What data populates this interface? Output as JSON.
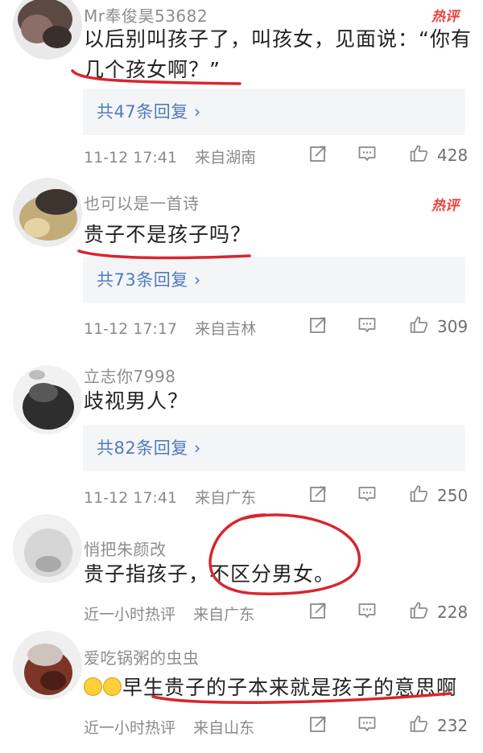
{
  "labels": {
    "hot": "热评"
  },
  "colors": {
    "accent_red": "#d8262f",
    "link_blue": "#4f7bbd",
    "hot_red": "#e8453c"
  },
  "icons": [
    "repost-icon",
    "comment-icon",
    "like-icon"
  ],
  "comments": [
    {
      "username": "Mr奉俊昊53682",
      "hot": true,
      "text_lines": [
        "以后别叫孩子了，叫孩女，见面说：“你有",
        "几个孩女啊？”"
      ],
      "replies": "共47条回复 ›",
      "time": "11-12 17:41",
      "location": "来自湖南",
      "likes": "428"
    },
    {
      "username": "也可以是一首诗",
      "hot": true,
      "text_lines": [
        "贵子不是孩子吗？"
      ],
      "replies": "共73条回复 ›",
      "time": "11-12 17:17",
      "location": "来自吉林",
      "likes": "309"
    },
    {
      "username": "立志你7998",
      "hot": false,
      "text_lines": [
        "歧视男人？"
      ],
      "replies": "共82条回复 ›",
      "time": "11-12 17:41",
      "location": "来自广东",
      "likes": "250"
    },
    {
      "username": "悄把朱颜改",
      "hot": false,
      "text_lines": [
        "贵子指孩子，不区分男女。"
      ],
      "time": "近一小时热评",
      "location": "来自广东",
      "likes": "228"
    },
    {
      "username": "爱吃锅粥的虫虫",
      "hot": false,
      "text_lines": [
        "早生贵子的子本来就是孩子的意思啊"
      ],
      "time": "近一小时热评",
      "location": "来自山东",
      "likes": "232"
    }
  ]
}
